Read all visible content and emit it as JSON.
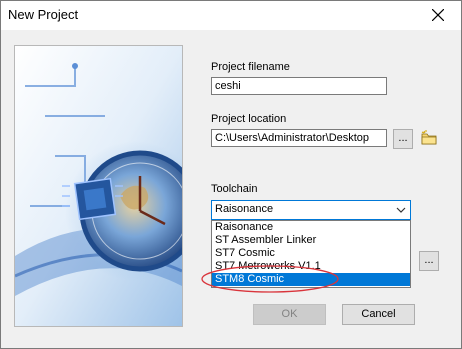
{
  "window": {
    "title": "New Project",
    "close_icon": "close-icon"
  },
  "form": {
    "filename_label": "Project filename",
    "filename_value": "ceshi",
    "location_label": "Project location",
    "location_value": "C:\\Users\\Administrator\\Desktop",
    "browse_label": "...",
    "folder_icon": "folder-icon",
    "toolchain_label": "Toolchain",
    "toolchain_selected": "Raisonance",
    "toolchain_options": [
      "Raisonance",
      "ST Assembler Linker",
      "ST7 Cosmic",
      "ST7 Metrowerks V1.1",
      "STM8 Cosmic"
    ],
    "highlighted_option": "STM8 Cosmic",
    "extra_browse_label": "..."
  },
  "buttons": {
    "ok_label": "OK",
    "cancel_label": "Cancel"
  },
  "colors": {
    "selection": "#0078d7",
    "annotation": "#d9343b",
    "focus_border": "#0078d7"
  }
}
